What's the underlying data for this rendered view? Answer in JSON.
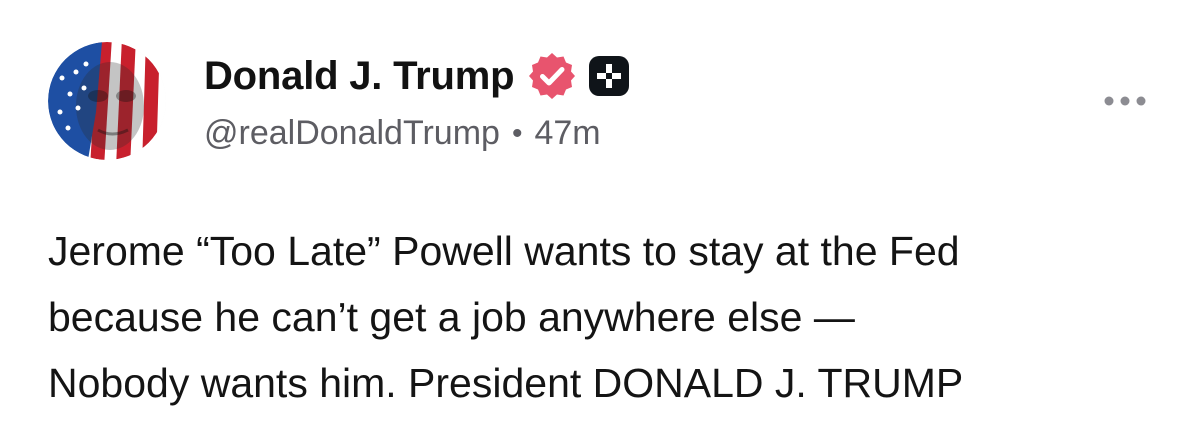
{
  "post": {
    "author": {
      "display_name": "Donald J. Trump",
      "handle": "@realDonaldTrump",
      "avatar_icon": "flag-portrait-avatar",
      "verified_icon": "verified-badge-icon",
      "plus_icon": "plus-badge-icon"
    },
    "separator": "•",
    "timestamp": "47m",
    "body_lines": [
      "Jerome “Too Late” Powell wants to stay at the Fed",
      "because he can’t get a job anywhere else —",
      "Nobody wants him. President DONALD J. TRUMP"
    ],
    "more_icon": "more-options-icon",
    "colors": {
      "verified_badge": "#e8546e",
      "plus_badge": "#0f1419",
      "handle_text": "#5d5d63",
      "body_text": "#141414"
    }
  }
}
